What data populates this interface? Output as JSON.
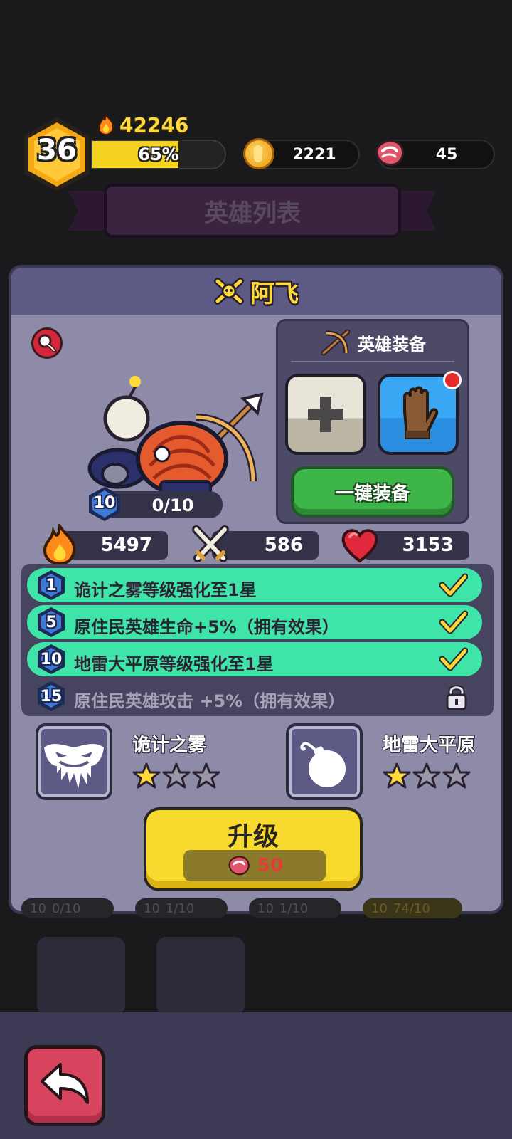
{
  "player": {
    "level": "36",
    "power": "42246",
    "xp_percent_label": "65%",
    "xp_fraction": 0.65
  },
  "resources": {
    "coins": "2221",
    "meat": "45"
  },
  "background": {
    "banner_title": "英雄列表"
  },
  "hero": {
    "name": "阿飞",
    "level": "10",
    "shards": "0/10",
    "stats": {
      "power": "5497",
      "attack": "586",
      "hp": "3153"
    }
  },
  "equipment": {
    "title": "英雄装备",
    "auto_equip_label": "一键装备"
  },
  "perks": [
    {
      "level": "1",
      "text": "诡计之雾等级强化至1星",
      "unlocked": true
    },
    {
      "level": "5",
      "text": "原住民英雄生命+5%（拥有效果）",
      "unlocked": true
    },
    {
      "level": "10",
      "text": "地雷大平原等级强化至1星",
      "unlocked": true
    },
    {
      "level": "15",
      "text": "原住民英雄攻击  +5%（拥有效果）",
      "unlocked": false
    }
  ],
  "skills": [
    {
      "name": "诡计之雾",
      "stars": 1,
      "max_stars": 3
    },
    {
      "name": "地雷大平原",
      "stars": 1,
      "max_stars": 3
    }
  ],
  "upgrade": {
    "label": "升级",
    "cost": "50"
  },
  "background_list": {
    "items": [
      {
        "level": "10",
        "progress": "0/10"
      },
      {
        "level": "10",
        "progress": "1/10"
      },
      {
        "level": "10",
        "progress": "1/10"
      },
      {
        "level": "10",
        "progress": "74/10"
      }
    ]
  },
  "colors": {
    "accent_yellow": "#f8d92e",
    "perk_active": "#3fe4a8",
    "panel": "#8e8ba8",
    "header": "#5e5a86"
  }
}
